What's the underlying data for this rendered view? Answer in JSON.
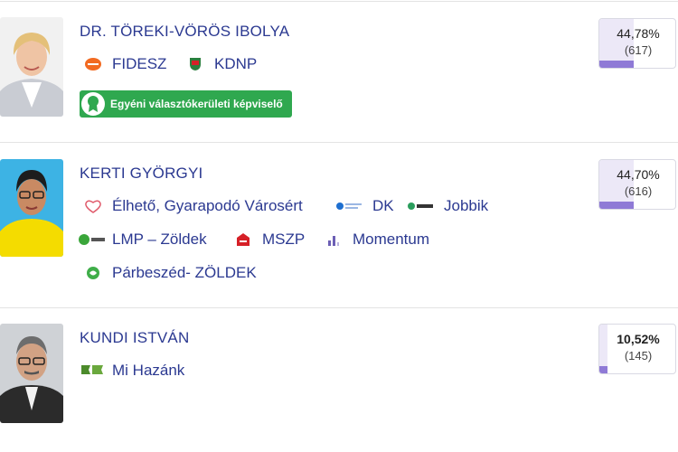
{
  "candidates": [
    {
      "name": "DR. TÖREKI-VÖRÖS IBOLYA",
      "parties": [
        {
          "label": "FIDESZ",
          "icon": "fidesz-logo-icon",
          "color": "#f26a21"
        },
        {
          "label": "KDNP",
          "icon": "kdnp-logo-icon",
          "color": "#2a7f3e"
        }
      ],
      "badge": "Egyéni választókerületi képviselő",
      "percent": "44,78%",
      "votes": "(617)",
      "share": 0.4478
    },
    {
      "name": "KERTI GYÖRGYI",
      "parties": [
        {
          "label": "Élhető, Gyarapodó Városért",
          "icon": "elheto-logo-icon",
          "color": "#e05a6b"
        },
        {
          "label": "DK",
          "icon": "dk-logo-icon",
          "color": "#1e6fd0"
        },
        {
          "label": "Jobbik",
          "icon": "jobbik-logo-icon",
          "color": "#2a9d5c"
        },
        {
          "label": "LMP – Zöldek",
          "icon": "lmp-logo-icon",
          "color": "#3aa63a"
        },
        {
          "label": "MSZP",
          "icon": "mszp-logo-icon",
          "color": "#d62027"
        },
        {
          "label": "Momentum",
          "icon": "momentum-logo-icon",
          "color": "#6c5fb5"
        },
        {
          "label": "Párbeszéd- ZÖLDEK",
          "icon": "parbeszed-logo-icon",
          "color": "#3fae49"
        }
      ],
      "percent": "44,70%",
      "votes": "(616)",
      "share": 0.447
    },
    {
      "name": "KUNDI ISTVÁN",
      "parties": [
        {
          "label": "Mi Hazánk",
          "icon": "mi-hazank-logo-icon",
          "color": "#4c8b2b"
        }
      ],
      "percent": "10,52%",
      "votes": "(145)",
      "share": 0.1052
    }
  ],
  "colors": {
    "name": "#2b3991",
    "badge": "#2fa84f",
    "bar": "#8f7ad6",
    "bar_bg": "#ece8f7"
  }
}
